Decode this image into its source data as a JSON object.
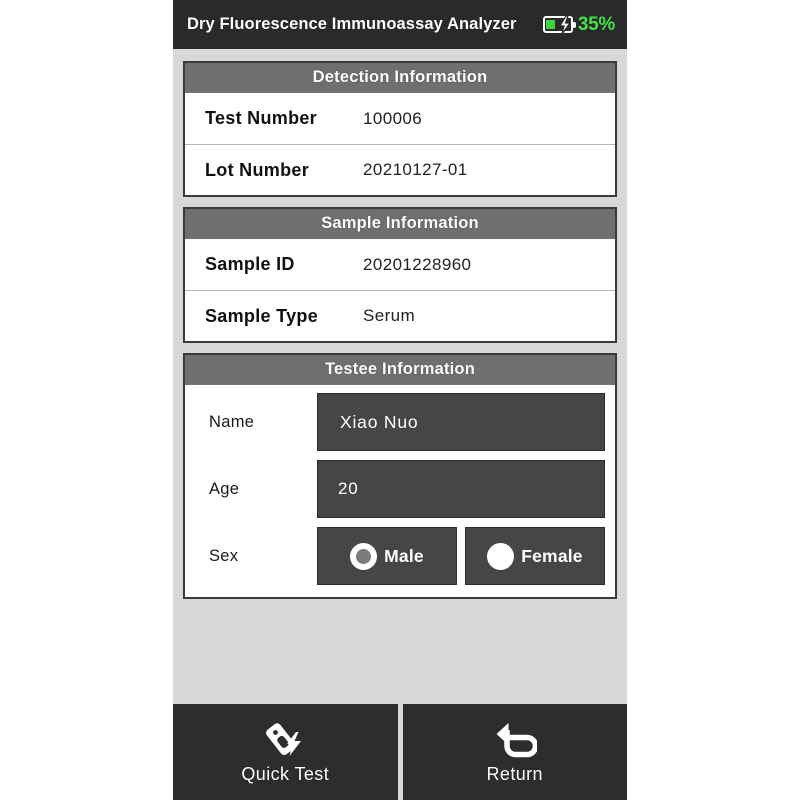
{
  "statusbar": {
    "title": "Dry Fluorescence Immunoassay Analyzer",
    "battery_percent": "35%",
    "battery_icon": "battery-charging-icon",
    "battery_level": 35,
    "battery_color": "#45e045"
  },
  "sections": {
    "detection": {
      "header": "Detection Information",
      "rows": [
        {
          "label": "Test Number",
          "value": "100006"
        },
        {
          "label": "Lot Number",
          "value": "20210127-01"
        }
      ]
    },
    "sample": {
      "header": "Sample Information",
      "rows": [
        {
          "label": "Sample ID",
          "value": "20201228960"
        },
        {
          "label": "Sample Type",
          "value": "Serum"
        }
      ]
    },
    "testee": {
      "header": "Testee Information",
      "name": {
        "label": "Name",
        "value": "Xiao  Nuo"
      },
      "age": {
        "label": "Age",
        "value": "20"
      },
      "sex": {
        "label": "Sex",
        "options": [
          {
            "label": "Male",
            "selected": true
          },
          {
            "label": "Female",
            "selected": false
          }
        ]
      }
    }
  },
  "toolbar": {
    "quick_test": {
      "label": "Quick Test",
      "icon": "test-strip-lightning-icon"
    },
    "return": {
      "label": "Return",
      "icon": "return-arrow-icon"
    }
  },
  "colors": {
    "screen_bg": "#d8d8d8",
    "statusbar_bg": "#2a2a2a",
    "panel_header_bg": "#6f6f6f",
    "field_bg": "#464646",
    "toolbar_bg": "#2d2d2d"
  }
}
